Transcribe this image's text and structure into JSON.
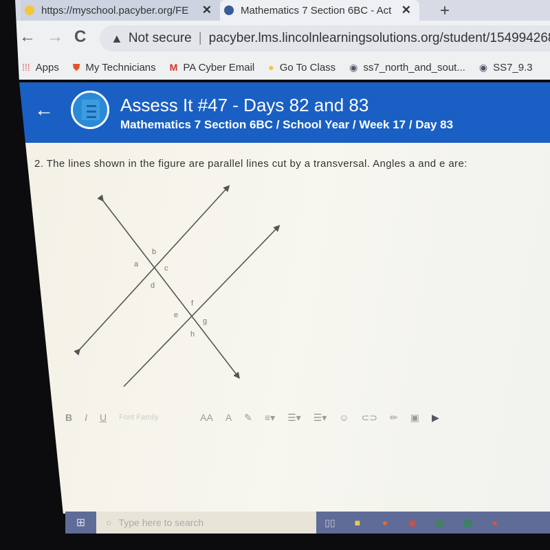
{
  "browser": {
    "tabs": [
      {
        "title": "https://myschool.pacyber.org/FE",
        "close": "✕",
        "active": false
      },
      {
        "title": "Mathematics 7 Section 6BC - Act",
        "close": "✕",
        "active": true
      }
    ],
    "new_tab": "+",
    "nav": {
      "back": "←",
      "forward": "→",
      "reload": "C"
    },
    "security_label": "Not secure",
    "url": "pacyber.lms.lincolnlearningsolutions.org/student/154994268/activ",
    "bookmarks": [
      {
        "label": "Apps",
        "icon": "apps-grid-icon"
      },
      {
        "label": "My Technicians",
        "icon": "shield-icon"
      },
      {
        "label": "PA Cyber Email",
        "icon": "gmail-icon"
      },
      {
        "label": "Go To Class",
        "icon": "lightbulb-icon"
      },
      {
        "label": "ss7_north_and_sout...",
        "icon": "globe-icon"
      },
      {
        "label": "SS7_9.3",
        "icon": "globe-icon"
      }
    ]
  },
  "header": {
    "back": "←",
    "title": "Assess It #47 - Days 82 and 83",
    "breadcrumb": "Mathematics 7 Section 6BC / School Year / Week 17 / Day 83",
    "accent": "#1a5fc4"
  },
  "question": {
    "text": "2. The lines shown in the figure are parallel lines cut by a transversal.  Angles a and e are:",
    "angle_labels": [
      "a",
      "b",
      "c",
      "d",
      "e",
      "f",
      "g",
      "h"
    ]
  },
  "editor": {
    "bold": "B",
    "italic": "I",
    "underline": "U",
    "font_family_placeholder": "Font Family",
    "font_size": "AA",
    "font_color": "A"
  },
  "taskbar": {
    "search_placeholder": "Type here to search"
  }
}
